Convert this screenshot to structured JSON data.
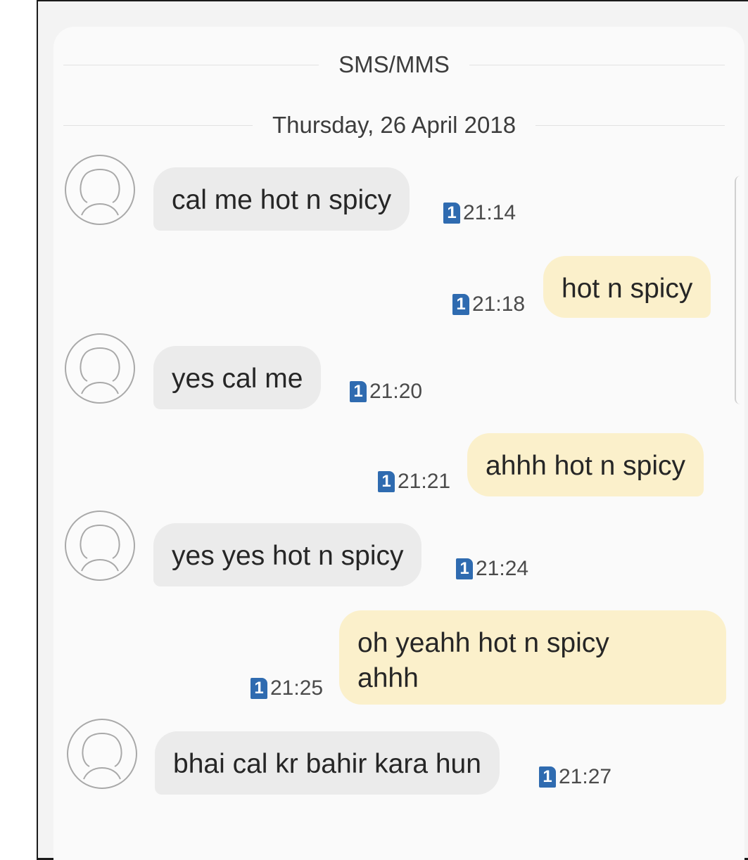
{
  "header": {
    "channel_label": "SMS/MMS",
    "date_label": "Thursday, 26 April 2018"
  },
  "messages": [
    {
      "direction": "incoming",
      "text": "cal me hot n spicy",
      "sim": "1",
      "time": "21:14"
    },
    {
      "direction": "outgoing",
      "text": "hot n spicy",
      "sim": "1",
      "time": "21:18"
    },
    {
      "direction": "incoming",
      "text": "yes cal me",
      "sim": "1",
      "time": "21:20"
    },
    {
      "direction": "outgoing",
      "text": "ahhh hot n spicy",
      "sim": "1",
      "time": "21:21"
    },
    {
      "direction": "incoming",
      "text": "yes yes hot n spicy",
      "sim": "1",
      "time": "21:24"
    },
    {
      "direction": "outgoing",
      "text": "oh yeahh hot n spicy\nahhh",
      "sim": "1",
      "time": "21:25"
    },
    {
      "direction": "incoming",
      "text": "bhai cal kr bahir kara hun",
      "sim": "1",
      "time": "21:27"
    }
  ],
  "icons": {
    "avatar": "contact-silhouette-icon",
    "sim": "sim-1-badge-icon"
  },
  "colors": {
    "incoming_bubble": "#ebebeb",
    "outgoing_bubble": "#fbf0cb",
    "sim_badge": "#2f6bb0"
  }
}
